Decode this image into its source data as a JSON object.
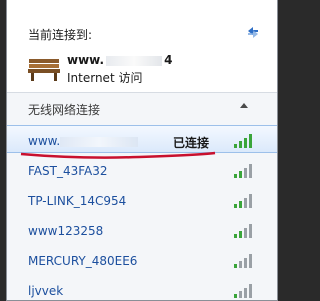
{
  "header": {
    "title": "当前连接到:"
  },
  "current_connection": {
    "name": "www.",
    "name_suffix": "4",
    "type": "Internet 访问",
    "icon": "bench-icon"
  },
  "section": {
    "label": "无线网络连接",
    "collapse_icon": "chevron-up-icon"
  },
  "networks": [
    {
      "name": "www.",
      "status": "已连接",
      "selected": true
    },
    {
      "name": "FAST_43FA32"
    },
    {
      "name": "TP-LINK_14C954"
    },
    {
      "name": "www123258"
    },
    {
      "name": "MERCURY_480EE6"
    },
    {
      "name": "ljvvek"
    }
  ],
  "colors": {
    "link": "#1c4f9e",
    "selection": "#dbe9fb",
    "signal": "#3aa53a",
    "annotation": "#c8102e"
  }
}
